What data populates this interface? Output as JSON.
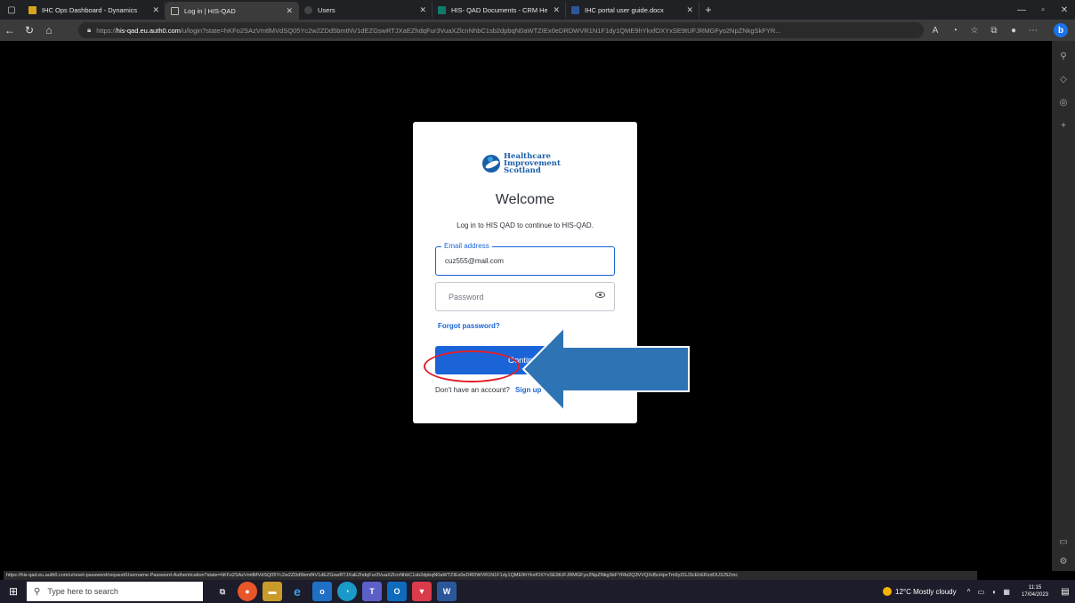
{
  "browser": {
    "tabs": [
      {
        "title": "IHC Ops Dashboard - Dynamics",
        "icon": "dynamics-icon",
        "color": "#d9a21f"
      },
      {
        "title": "Log in | HIS-QAD",
        "icon": "page-icon",
        "color": "#bbbbbb",
        "active": true
      },
      {
        "title": "Users",
        "icon": "users-icon",
        "color": "#444444"
      },
      {
        "title": "HIS- QAD Documents - CRM Hel",
        "icon": "sharepoint-icon",
        "color": "#0f7b6c"
      },
      {
        "title": "IHC portal user guide.docx",
        "icon": "word-icon",
        "color": "#2b579a"
      }
    ],
    "url_prefix": "https://",
    "url_host": "his-qad.eu.auth0.com",
    "url_rest": "/u/login?state=hKFo2SAzVmtlMVdSQ05Yc2w2ZDd5bmtNV1dEZGswRTJXaEZhdqFur3VuaXZlcnNhbC1sb2dpbqN0aWTZIEx0eDRDWVR1N1F1dy1QME9hYkxfOXYxSE9tUFJRMGFyo2NpZNkgSkFYR..."
  },
  "login": {
    "logo_lines": [
      "Healthcare",
      "Improvement",
      "Scotland"
    ],
    "title": "Welcome",
    "subtitle": "Log in to HIS QAD to continue to HIS-QAD.",
    "email_label": "Email address",
    "email_value": "cuz555@mail.com",
    "password_placeholder": "Password",
    "forgot_label": "Forgot password?",
    "continue_label": "Continue",
    "no_account_text": "Don't have an account?",
    "signup_label": "Sign up"
  },
  "status_url": "https://his-qad.eu.auth0.com/u/reset-password/request/Username-Password-Authentication?state=hKFo2SAzVmtlMVdSQ05Yc2w2ZDd5bmtNV1dEZGswRTJXaEZhdqFur3VuaXZlcnNhbC1sb2dpbqN0aWTZIEx0eDRDWVR1N1F1dy1QME9hYkxfOXYxSE9tUFJRMGFyo2NpZNkgSkFYRkt2Q3VVQXd5cHpvTm9yZGJ3cEhERzdOU3JSZmc",
  "taskbar": {
    "search_placeholder": "Type here to search",
    "weather": "12°C  Mostly cloudy",
    "time": "11:15",
    "date": "17/04/2023"
  },
  "colors": {
    "accent": "#1a64d8",
    "annotation_red": "#e0202a",
    "annotation_arrow": "#2e74b5"
  }
}
